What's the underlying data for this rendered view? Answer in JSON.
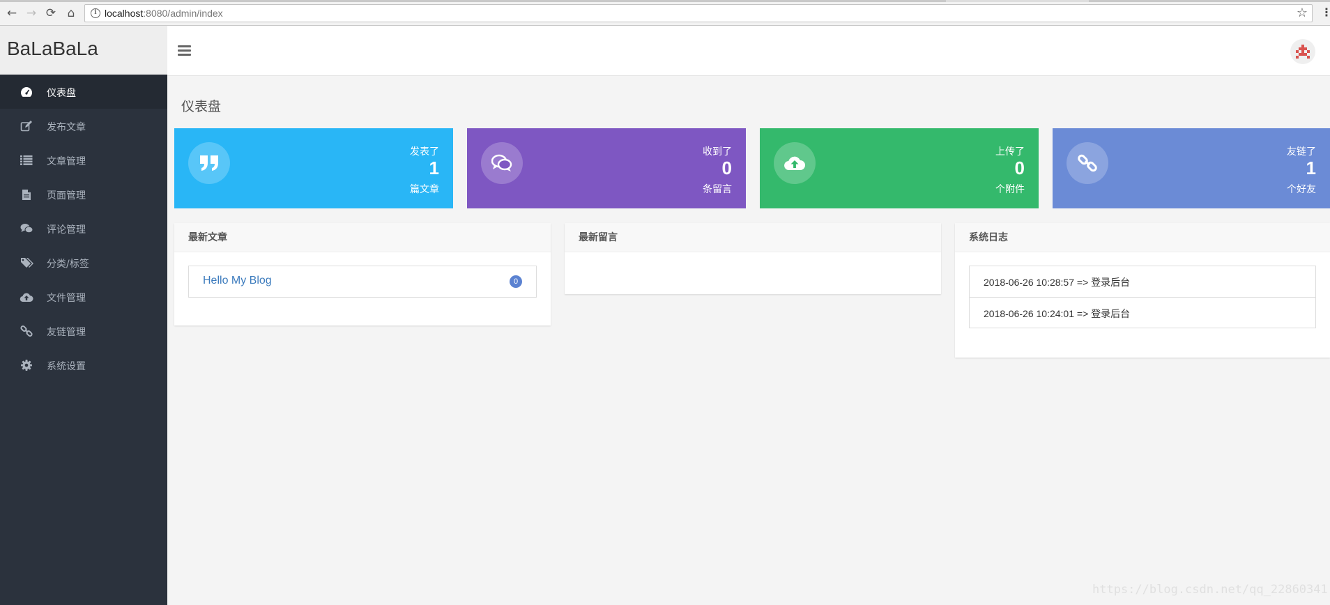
{
  "browser": {
    "url_host": "localhost",
    "url_path": ":8080/admin/index",
    "back_glyph": "←",
    "forward_glyph": "→",
    "reload_glyph": "⟳",
    "home_glyph": "⌂",
    "info_glyph": "i",
    "star_glyph": "☆",
    "menu_glyph": "⋮"
  },
  "brand": {
    "name": "BaLaBaLa"
  },
  "sidebar": {
    "items": [
      {
        "label": "仪表盘",
        "icon": "dashboard-icon",
        "active": true
      },
      {
        "label": "发布文章",
        "icon": "edit-icon"
      },
      {
        "label": "文章管理",
        "icon": "list-icon"
      },
      {
        "label": "页面管理",
        "icon": "file-icon"
      },
      {
        "label": "评论管理",
        "icon": "comments-icon"
      },
      {
        "label": "分类/标签",
        "icon": "tags-icon"
      },
      {
        "label": "文件管理",
        "icon": "cloud-upload-icon"
      },
      {
        "label": "友链管理",
        "icon": "link-icon"
      },
      {
        "label": "系统设置",
        "icon": "gear-icon"
      }
    ]
  },
  "page": {
    "title": "仪表盘"
  },
  "stats": [
    {
      "pre": "发表了",
      "value": "1",
      "post": "篇文章",
      "color": "#29b6f6",
      "icon": "quote-icon"
    },
    {
      "pre": "收到了",
      "value": "0",
      "post": "条留言",
      "color": "#7e57c2",
      "icon": "comments-icon"
    },
    {
      "pre": "上传了",
      "value": "0",
      "post": "个附件",
      "color": "#34b96c",
      "icon": "cloud-upload-icon"
    },
    {
      "pre": "友链了",
      "value": "1",
      "post": "个好友",
      "color": "#6b8bd6",
      "icon": "link-icon"
    }
  ],
  "panels": {
    "articles": {
      "title": "最新文章",
      "items": [
        {
          "title": "Hello My Blog",
          "count": "0"
        }
      ]
    },
    "comments": {
      "title": "最新留言"
    },
    "logs": {
      "title": "系统日志",
      "items": [
        "2018-06-26 10:28:57 => 登录后台",
        "2018-06-26 10:24:01 => 登录后台"
      ]
    }
  },
  "watermark": "https://blog.csdn.net/qq_22860341"
}
